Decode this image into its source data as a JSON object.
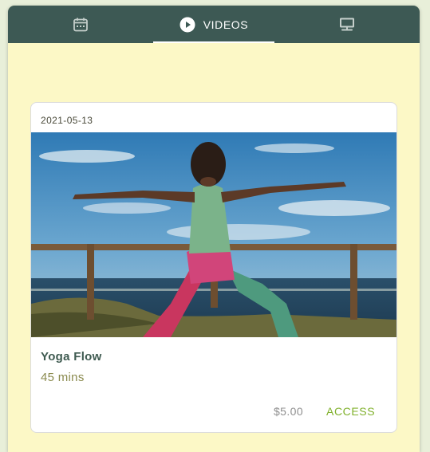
{
  "tabs": [
    {
      "label": "",
      "icon": "calendar-icon",
      "active": false
    },
    {
      "label": "VIDEOS",
      "icon": "play-circle-icon",
      "active": true
    },
    {
      "label": "",
      "icon": "presentation-board-icon",
      "active": false
    }
  ],
  "card": {
    "date": "2021-05-13",
    "title": "Yoga Flow",
    "duration": "45 mins",
    "price": "$5.00",
    "action_label": "ACCESS",
    "image_alt": "Woman in warrior II yoga pose facing the sea"
  },
  "colors": {
    "tabbar": "#3d5954",
    "panel_bg": "#fcf8c6",
    "accent_green": "#7fb02a",
    "title_green": "#3e5a50",
    "duration_olive": "#8a8a4e"
  }
}
